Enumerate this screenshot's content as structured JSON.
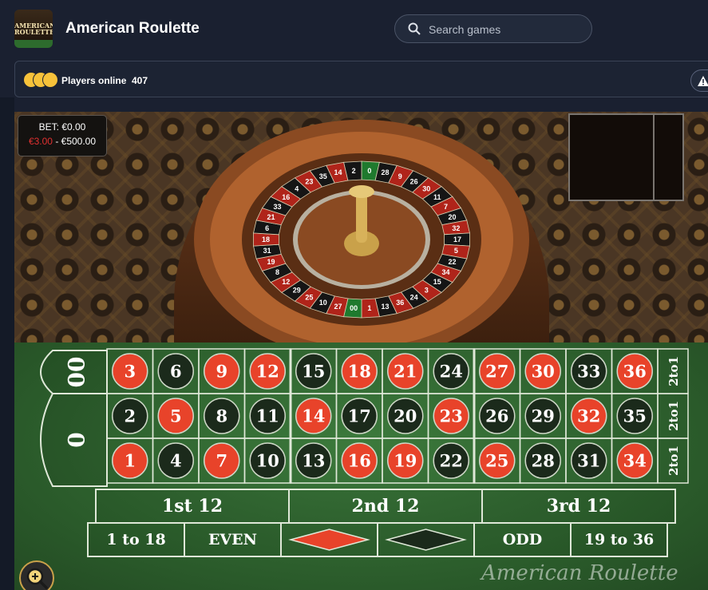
{
  "header": {
    "title": "American Roulette",
    "logo_text_line1": "AMERICAN",
    "logo_text_line2": "ROULETTE",
    "search_placeholder": "Search games"
  },
  "infobar": {
    "players_label": "Players online",
    "players_count": "407"
  },
  "game": {
    "bet_label": "BET: €0.00",
    "bet_min": "€3.00",
    "bet_range_sep": " - ",
    "bet_max": "€500.00",
    "watermark": "American Roulette",
    "zeros": [
      "00",
      "0"
    ],
    "number_grid": [
      [
        3,
        6,
        9,
        12,
        15,
        18,
        21,
        24,
        27,
        30,
        33,
        36
      ],
      [
        2,
        5,
        8,
        11,
        14,
        17,
        20,
        23,
        26,
        29,
        32,
        35
      ],
      [
        1,
        4,
        7,
        10,
        13,
        16,
        19,
        22,
        25,
        28,
        31,
        34
      ]
    ],
    "red_numbers": [
      1,
      3,
      5,
      7,
      9,
      12,
      14,
      16,
      18,
      19,
      21,
      23,
      25,
      27,
      30,
      32,
      34,
      36
    ],
    "column_bets": [
      "2to1",
      "2to1",
      "2to1"
    ],
    "dozens": [
      "1st 12",
      "2nd 12",
      "3rd 12"
    ],
    "outside_bets": [
      "1 to 18",
      "EVEN",
      "RED",
      "BLACK",
      "ODD",
      "19 to 36"
    ],
    "wheel_numbers": [
      "0",
      "28",
      "9",
      "26",
      "30",
      "11",
      "7",
      "20",
      "32",
      "17",
      "5",
      "22",
      "34",
      "15",
      "3",
      "24",
      "36",
      "13",
      "1",
      "00",
      "27",
      "10",
      "25",
      "29",
      "12",
      "8",
      "19",
      "31",
      "18",
      "6",
      "21",
      "33",
      "16",
      "4",
      "23",
      "35",
      "14",
      "2"
    ]
  },
  "colors": {
    "red": "#e8432a",
    "black": "#1b2a1b",
    "felt": "#2f6a2f",
    "accent": "#c9a14a"
  }
}
